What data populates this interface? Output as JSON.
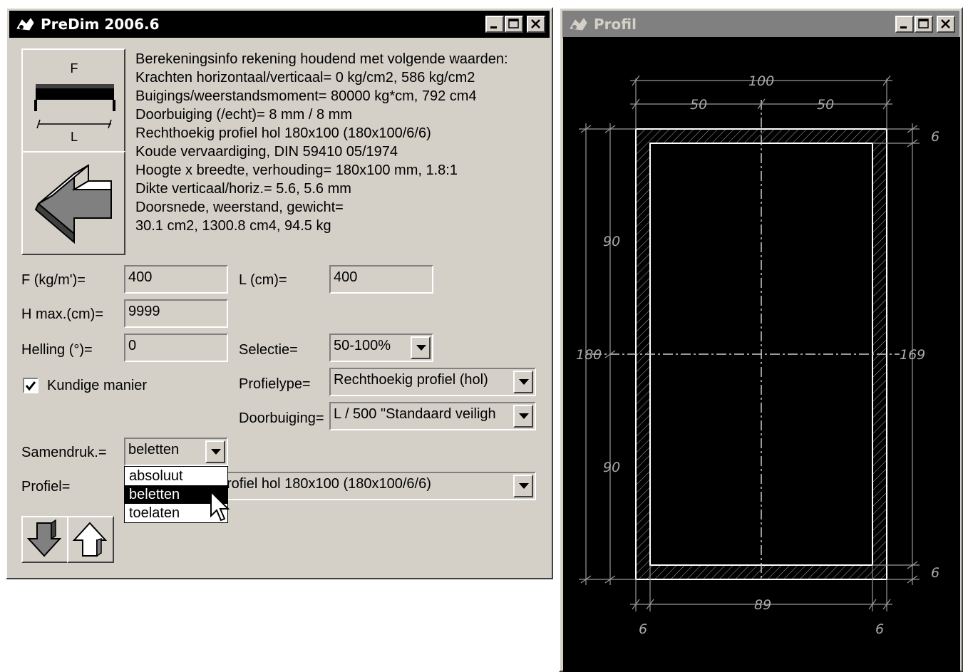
{
  "main_window": {
    "title": "PreDim 2006.6",
    "info_lines": [
      "Berekeningsinfo rekening houdend met volgende waarden:",
      "Krachten horizontaal/verticaal= 0 kg/cm2, 586 kg/cm2",
      "Buigings/weerstandsmoment= 80000 kg*cm, 792 cm4",
      "Doorbuiging (/echt)= 8 mm / 8 mm",
      "Rechthoekig profiel hol 180x100 (180x100/6/6)",
      "Koude vervaardiging, DIN 59410 05/1974",
      "Hoogte x breedte, verhouding= 180x100 mm, 1.8:1",
      "Dikte verticaal/horiz.= 5.6, 5.6 mm",
      "Doorsnede, weerstand, gewicht=",
      "30.1 cm2, 1300.8 cm4, 94.5 kg"
    ],
    "beam_icon": {
      "force_label": "F",
      "length_label": "L"
    },
    "fields": {
      "f_label": "F (kg/m')=",
      "f_value": "400",
      "l_label": "L (cm)=",
      "l_value": "400",
      "hmax_label": "H max.(cm)=",
      "hmax_value": "9999",
      "helling_label": "Helling (°)=",
      "helling_value": "0",
      "selectie_label": "Selectie=",
      "selectie_value": "50-100%",
      "kundig_label": "Kundige manier",
      "kundig_checked": true,
      "profieltype_label": "Profielype=",
      "profieltype_value": "Rechthoekig profiel (hol)",
      "doorbuiging_label": "Doorbuiging=",
      "doorbuiging_value": "L / 500 \"Standaard veiligh",
      "samendruk_label": "Samendruk.=",
      "samendruk_value": "beletten",
      "profiel_label": "Profiel=",
      "profiel_value": "rofiel hol 180x100 (180x100/6/6)"
    },
    "samendruk_options": [
      "absoluut",
      "beletten",
      "toelaten"
    ],
    "samendruk_selected_index": 1
  },
  "profile_window": {
    "title": "Profil",
    "dims": {
      "top_total": "100",
      "top_left": "50",
      "top_right": "50",
      "left_top": "90",
      "left_total": "180",
      "left_bottom": "90",
      "right_inner": "169",
      "right_top_wall": "6",
      "right_bottom_wall": "6",
      "bottom_inner": "89",
      "bottom_left_wall": "6",
      "bottom_right_wall": "6"
    }
  },
  "colors": {
    "window_bg": "#d4d0c8",
    "titlebar": "#000000",
    "canvas_bg": "#000000",
    "drawing": "#ffffff"
  }
}
